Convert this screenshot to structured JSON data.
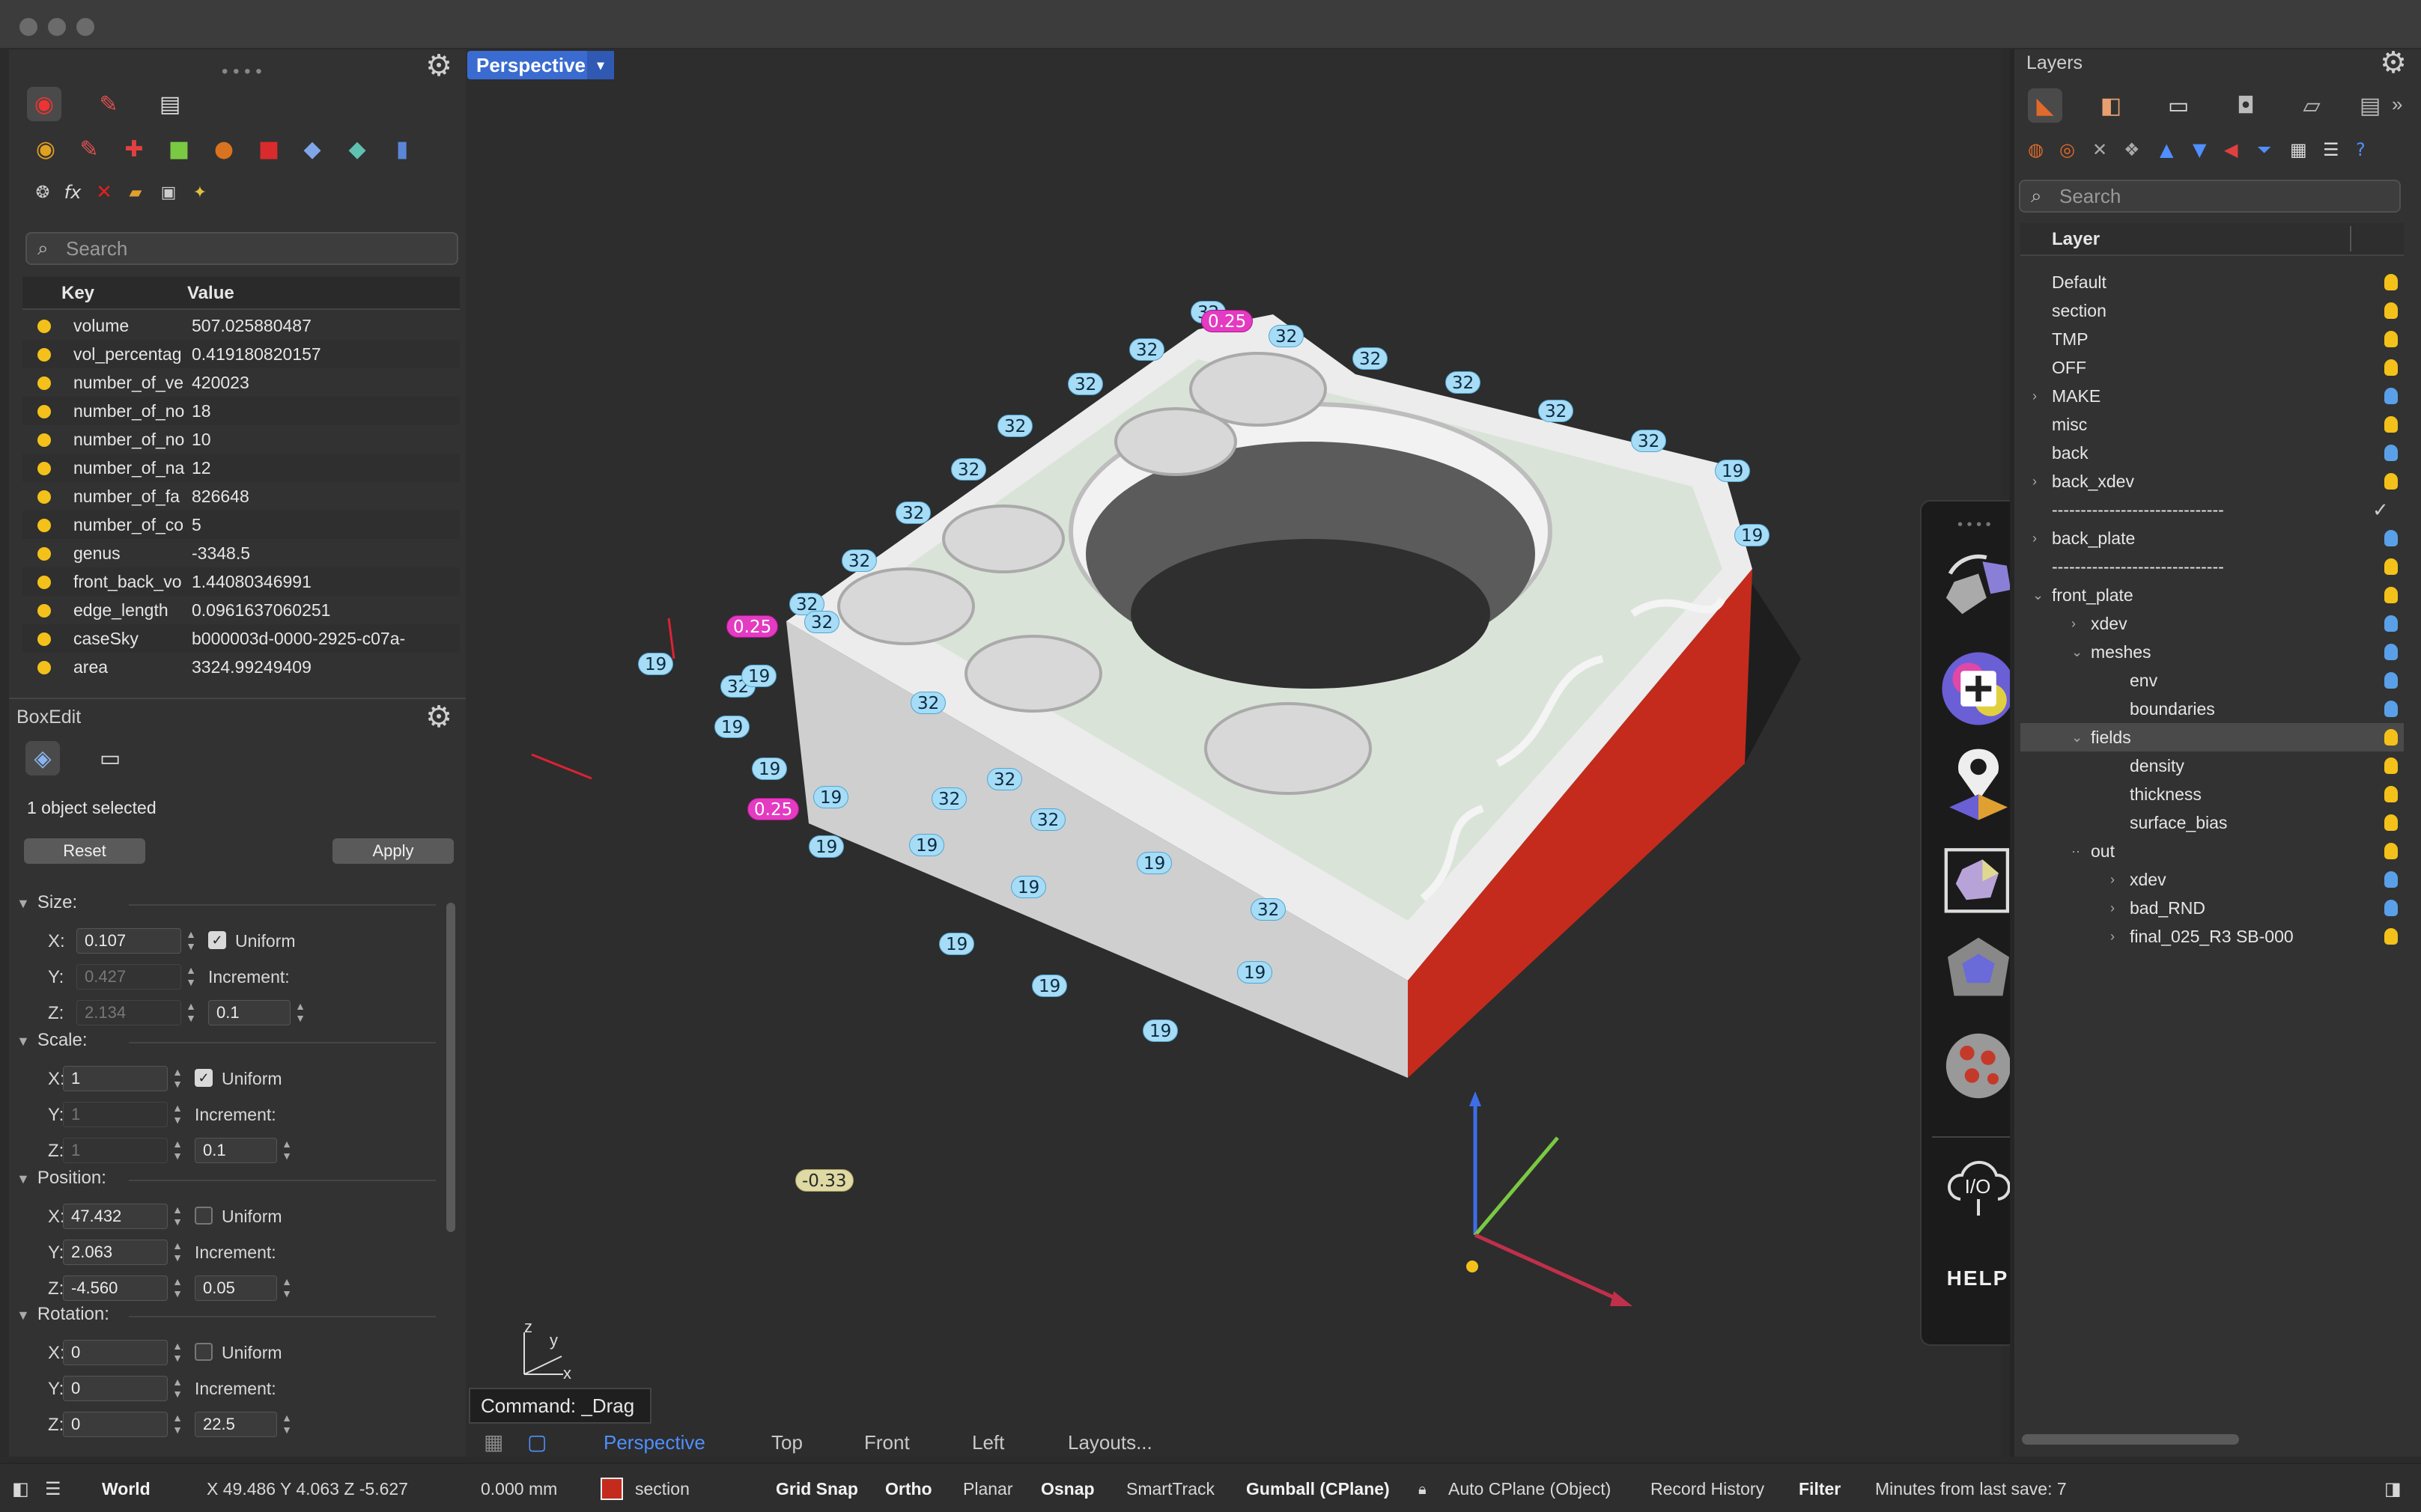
{
  "viewport": {
    "name": "Perspective",
    "command": "Command: _Drag",
    "tabs": [
      "Perspective",
      "Top",
      "Front",
      "Left",
      "Layouts..."
    ],
    "axis_labels": {
      "z": "z",
      "y": "y",
      "x": "x"
    },
    "annotations": [
      {
        "t": "32",
        "k": "c"
      },
      {
        "t": "0.25",
        "k": "m"
      },
      {
        "t": "32",
        "k": "c"
      },
      {
        "t": "32",
        "k": "c"
      },
      {
        "t": "32",
        "k": "c"
      },
      {
        "t": "32",
        "k": "c"
      },
      {
        "t": "32",
        "k": "c"
      },
      {
        "t": "32",
        "k": "c"
      },
      {
        "t": "32",
        "k": "c"
      },
      {
        "t": "32",
        "k": "c"
      },
      {
        "t": "32",
        "k": "c"
      },
      {
        "t": "32",
        "k": "c"
      },
      {
        "t": "32",
        "k": "c"
      },
      {
        "t": "19",
        "k": "c"
      },
      {
        "t": "32",
        "k": "c"
      },
      {
        "t": "0.25",
        "k": "m"
      },
      {
        "t": "32",
        "k": "c"
      },
      {
        "t": "19",
        "k": "c"
      },
      {
        "t": "32",
        "k": "c"
      },
      {
        "t": "19",
        "k": "c"
      },
      {
        "t": "19",
        "k": "c"
      },
      {
        "t": "32",
        "k": "c"
      },
      {
        "t": "19",
        "k": "c"
      },
      {
        "t": "32",
        "k": "c"
      },
      {
        "t": "19",
        "k": "c"
      },
      {
        "t": "0.25",
        "k": "m"
      },
      {
        "t": "19",
        "k": "c"
      },
      {
        "t": "32",
        "k": "c"
      },
      {
        "t": "19",
        "k": "c"
      },
      {
        "t": "32",
        "k": "c"
      },
      {
        "t": "19",
        "k": "c"
      },
      {
        "t": "19",
        "k": "c"
      },
      {
        "t": "19",
        "k": "c"
      },
      {
        "t": "32",
        "k": "c"
      },
      {
        "t": "19",
        "k": "c"
      },
      {
        "t": "19",
        "k": "c"
      },
      {
        "t": "19",
        "k": "c"
      },
      {
        "t": "19",
        "k": "c"
      },
      {
        "t": "-0.33",
        "k": "y"
      }
    ]
  },
  "left": {
    "search_placeholder": "Search",
    "table_headers": {
      "key": "Key",
      "value": "Value"
    },
    "rows": [
      {
        "key": "volume",
        "value": "507.025880487"
      },
      {
        "key": "vol_percentag",
        "value": "0.419180820157"
      },
      {
        "key": "number_of_ve",
        "value": "420023"
      },
      {
        "key": "number_of_no",
        "value": "18"
      },
      {
        "key": "number_of_no",
        "value": "10"
      },
      {
        "key": "number_of_na",
        "value": "12"
      },
      {
        "key": "number_of_fa",
        "value": "826648"
      },
      {
        "key": "number_of_co",
        "value": "5"
      },
      {
        "key": "genus",
        "value": "-3348.5"
      },
      {
        "key": "front_back_vo",
        "value": "1.44080346991"
      },
      {
        "key": "edge_length",
        "value": "0.0961637060251"
      },
      {
        "key": "caseSky",
        "value": "b000003d-0000-2925-c07a-"
      },
      {
        "key": "area",
        "value": "3324.99249409"
      }
    ],
    "boxedit": {
      "title": "BoxEdit",
      "selected": "1 object selected",
      "reset": "Reset",
      "apply": "Apply",
      "size_label": "Size:",
      "scale_label": "Scale:",
      "position_label": "Position:",
      "rotation_label": "Rotation:",
      "uniform": "Uniform",
      "increment": "Increment:",
      "size": {
        "x": "0.107",
        "y": "0.427",
        "z": "2.134",
        "inc": "0.1"
      },
      "scale": {
        "x": "1",
        "y": "1",
        "z": "1",
        "inc": "0.1"
      },
      "position": {
        "x": "47.432",
        "y": "2.063",
        "z": "-4.560",
        "inc": "0.05"
      },
      "rotation": {
        "x": "0",
        "y": "0",
        "z": "0",
        "inc": "22.5"
      }
    }
  },
  "right": {
    "title": "Layers",
    "search_placeholder": "Search",
    "column": "Layer",
    "layers": [
      {
        "name": "Default",
        "depth": 0,
        "exp": "",
        "bulb": "y"
      },
      {
        "name": "section",
        "depth": 0,
        "exp": "",
        "bulb": "y"
      },
      {
        "name": "TMP",
        "depth": 0,
        "exp": "",
        "bulb": "y"
      },
      {
        "name": "OFF",
        "depth": 0,
        "exp": "",
        "bulb": "y"
      },
      {
        "name": "MAKE",
        "depth": 0,
        "exp": ">",
        "bulb": "b"
      },
      {
        "name": "misc",
        "depth": 0,
        "exp": "",
        "bulb": "y"
      },
      {
        "name": "back",
        "depth": 0,
        "exp": "",
        "bulb": "b"
      },
      {
        "name": "back_xdev",
        "depth": 0,
        "exp": ">",
        "bulb": "y"
      },
      {
        "name": "------------------------------",
        "depth": 0,
        "exp": "",
        "bulb": "",
        "check": "✓"
      },
      {
        "name": "back_plate",
        "depth": 0,
        "exp": ">",
        "bulb": "b"
      },
      {
        "name": "------------------------------",
        "depth": 0,
        "exp": "",
        "bulb": "y"
      },
      {
        "name": "front_plate",
        "depth": 0,
        "exp": "v",
        "bulb": "y"
      },
      {
        "name": "xdev",
        "depth": 1,
        "exp": ">",
        "bulb": "b"
      },
      {
        "name": "meshes",
        "depth": 1,
        "exp": "v",
        "bulb": "b"
      },
      {
        "name": "env",
        "depth": 2,
        "exp": "",
        "bulb": "b"
      },
      {
        "name": "boundaries",
        "depth": 2,
        "exp": "",
        "bulb": "b"
      },
      {
        "name": "fields",
        "depth": 1,
        "exp": "v",
        "bulb": "y",
        "selected": true
      },
      {
        "name": "density",
        "depth": 2,
        "exp": "",
        "bulb": "y"
      },
      {
        "name": "thickness",
        "depth": 2,
        "exp": "",
        "bulb": "y"
      },
      {
        "name": "surface_bias",
        "depth": 2,
        "exp": "",
        "bulb": "y"
      },
      {
        "name": "out",
        "depth": 1,
        "exp": "-",
        "bulb": "y"
      },
      {
        "name": "xdev",
        "depth": 2,
        "exp": ">",
        "bulb": "b"
      },
      {
        "name": "bad_RND",
        "depth": 2,
        "exp": ">",
        "bulb": "b"
      },
      {
        "name": "final_025_R3 SB-000",
        "depth": 2,
        "exp": ">",
        "bulb": "y"
      }
    ]
  },
  "floating_toolbar": {
    "io_label": "I/O",
    "help_label": "HELP"
  },
  "status": {
    "world": "World",
    "coords": "X 49.486 Y 4.063 Z -5.627",
    "units": "0.000 mm",
    "layer": "section",
    "layer_color": "#c42b1c",
    "items": [
      "Grid Snap",
      "Ortho",
      "Planar",
      "Osnap",
      "SmartTrack",
      "Gumball (CPlane)",
      "Auto CPlane (Object)",
      "Record History",
      "Filter",
      "Minutes from last save: 7"
    ]
  },
  "colors": {
    "viewport_tab": "#3a6bd1",
    "section_red": "#c42b1c",
    "annotation_cyan": "#a6dcf5",
    "annotation_magenta": "#e33bc1"
  }
}
